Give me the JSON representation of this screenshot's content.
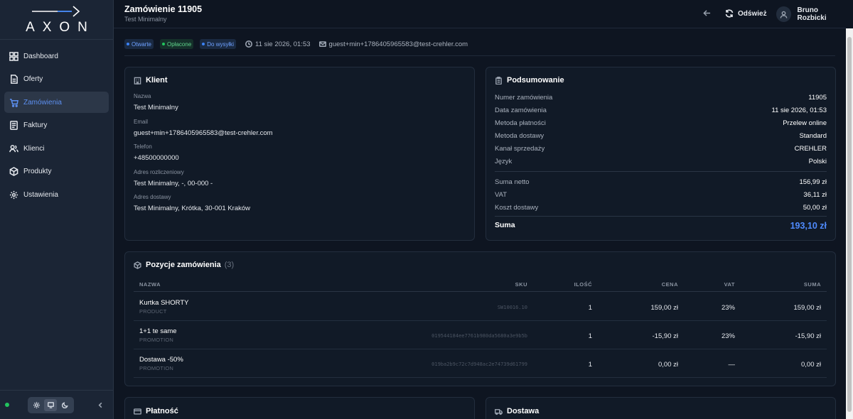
{
  "app": {
    "logo_text": "AXON"
  },
  "sidebar": {
    "items": [
      {
        "label": "Dashboard",
        "icon": "dashboard-icon"
      },
      {
        "label": "Oferty",
        "icon": "document-icon"
      },
      {
        "label": "Zamówienia",
        "icon": "cart-icon",
        "active": true
      },
      {
        "label": "Faktury",
        "icon": "invoice-icon"
      },
      {
        "label": "Klienci",
        "icon": "users-icon"
      },
      {
        "label": "Produkty",
        "icon": "box-icon"
      },
      {
        "label": "Ustawienia",
        "icon": "gear-icon"
      }
    ],
    "theme_options": [
      "sun-icon",
      "monitor-icon",
      "moon-icon"
    ],
    "selected_theme": "monitor-icon",
    "status_color": "#22c55e"
  },
  "header": {
    "title": "Zamówienie 11905",
    "subtitle": "Test Minimalny",
    "refresh_label": "Odśwież",
    "user_name": "Bruno Rozbicki"
  },
  "meta": {
    "badges": [
      {
        "label": "Otwarte",
        "color": "#3b82f6"
      },
      {
        "label": "Opłacone",
        "color": "#22c55e"
      },
      {
        "label": "Do wysyłki",
        "color": "#3b82f6"
      }
    ],
    "datetime": "11 sie 2026, 01:53",
    "email": "guest+min+1786405965583@test-crehler.com"
  },
  "client": {
    "title": "Klient",
    "fields": [
      {
        "label": "Nazwa",
        "value": "Test Minimalny"
      },
      {
        "label": "Email",
        "value": "guest+min+1786405965583@test-crehler.com"
      },
      {
        "label": "Telefon",
        "value": "+48500000000"
      },
      {
        "label": "Adres rozliczeniowy",
        "value": "Test Minimalny, -, 00-000 -"
      },
      {
        "label": "Adres dostawy",
        "value": "Test Minimalny, Krótka, 30-001 Kraków"
      }
    ]
  },
  "summary": {
    "title": "Podsumowanie",
    "rows": [
      {
        "label": "Numer zamówienia",
        "value": "11905"
      },
      {
        "label": "Data zamówienia",
        "value": "11 sie 2026, 01:53"
      },
      {
        "label": "Metoda płatności",
        "value": "Przelew online"
      },
      {
        "label": "Metoda dostawy",
        "value": "Standard"
      },
      {
        "label": "Kanał sprzedaży",
        "value": "CREHLER"
      },
      {
        "label": "Język",
        "value": "Polski"
      }
    ],
    "totals": [
      {
        "label": "Suma netto",
        "value": "156,99 zł"
      },
      {
        "label": "VAT",
        "value": "36,11 zł"
      },
      {
        "label": "Koszt dostawy",
        "value": "50,00 zł"
      }
    ],
    "grand_total": {
      "label": "Suma",
      "value": "193,10 zł"
    }
  },
  "items": {
    "title": "Pozycje zamówienia",
    "count": "(3)",
    "columns": {
      "name": "NAZWA",
      "sku": "SKU",
      "qty": "ILOŚĆ",
      "price": "CENA",
      "vat": "VAT",
      "sum": "SUMA"
    },
    "rows": [
      {
        "name": "Kurtka SHORTY",
        "type": "PRODUCT",
        "sku": "SW10016.10",
        "qty": "1",
        "price": "159,00 zł",
        "vat": "23%",
        "sum": "159,00 zł"
      },
      {
        "name": "1+1 te same",
        "type": "PROMOTION",
        "sku": "019544184ee7761b980da5680a3e9b5b",
        "qty": "1",
        "price": "-15,90 zł",
        "vat": "23%",
        "sum": "-15,90 zł"
      },
      {
        "name": "Dostawa -50%",
        "type": "PROMOTION",
        "sku": "019ba2b9c72c7d948ac2e74739d61799",
        "qty": "1",
        "price": "0,00 zł",
        "vat": "—",
        "sum": "0,00 zł"
      }
    ]
  },
  "bottom_cards": {
    "payment_title": "Płatność",
    "delivery_title": "Dostawa"
  }
}
